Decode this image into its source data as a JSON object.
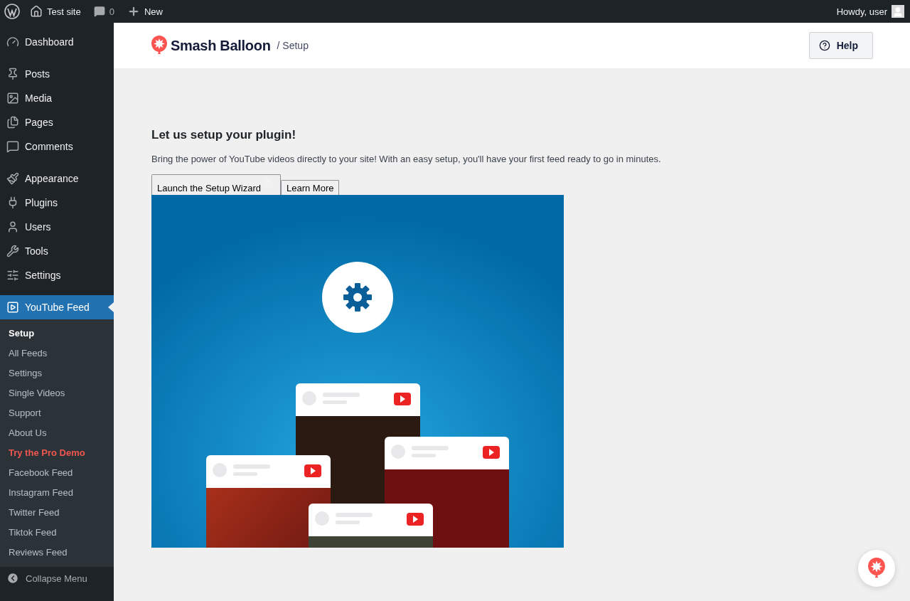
{
  "admin_bar": {
    "site_name": "Test site",
    "comments_count": "0",
    "new_label": "New",
    "greeting": "Howdy, user"
  },
  "sidebar": {
    "items": [
      {
        "label": "Dashboard",
        "selected": false,
        "separator_before": false
      },
      {
        "label": "Posts",
        "selected": false,
        "separator_before": true
      },
      {
        "label": "Media",
        "selected": false,
        "separator_before": false
      },
      {
        "label": "Pages",
        "selected": false,
        "separator_before": false
      },
      {
        "label": "Comments",
        "selected": false,
        "separator_before": false
      },
      {
        "label": "Appearance",
        "selected": false,
        "separator_before": true
      },
      {
        "label": "Plugins",
        "selected": false,
        "separator_before": false
      },
      {
        "label": "Users",
        "selected": false,
        "separator_before": false
      },
      {
        "label": "Tools",
        "selected": false,
        "separator_before": false
      },
      {
        "label": "Settings",
        "selected": false,
        "separator_before": false
      },
      {
        "label": "YouTube Feed",
        "selected": true,
        "separator_before": true
      }
    ],
    "submenu": [
      {
        "label": "Setup",
        "selected": true,
        "kind": "link"
      },
      {
        "label": "All Feeds",
        "selected": false,
        "kind": "link"
      },
      {
        "label": "Settings",
        "selected": false,
        "kind": "link"
      },
      {
        "label": "Single Videos",
        "selected": false,
        "kind": "link"
      },
      {
        "label": "Support",
        "selected": false,
        "kind": "link"
      },
      {
        "label": "About Us",
        "selected": false,
        "kind": "link"
      },
      {
        "label": "Try the Pro Demo",
        "selected": false,
        "kind": "promo"
      },
      {
        "label": "Facebook Feed",
        "selected": false,
        "kind": "link"
      },
      {
        "label": "Instagram Feed",
        "selected": false,
        "kind": "link"
      },
      {
        "label": "Twitter Feed",
        "selected": false,
        "kind": "link"
      },
      {
        "label": "Tiktok Feed",
        "selected": false,
        "kind": "link"
      },
      {
        "label": "Reviews Feed",
        "selected": false,
        "kind": "link"
      }
    ],
    "collapse_label": "Collapse Menu"
  },
  "header": {
    "brand": "Smash Balloon",
    "breadcrumb": "/ Setup",
    "help_label": "Help"
  },
  "content": {
    "title": "Let us setup your plugin!",
    "description": "Bring the power of YouTube videos directly to your site! With an easy setup, you'll have your first feed ready to go in minutes.",
    "buttons": [
      {
        "label": "Launch the Setup Wizard",
        "kind": "primary"
      },
      {
        "label": "Learn More",
        "kind": "secondary"
      }
    ]
  }
}
